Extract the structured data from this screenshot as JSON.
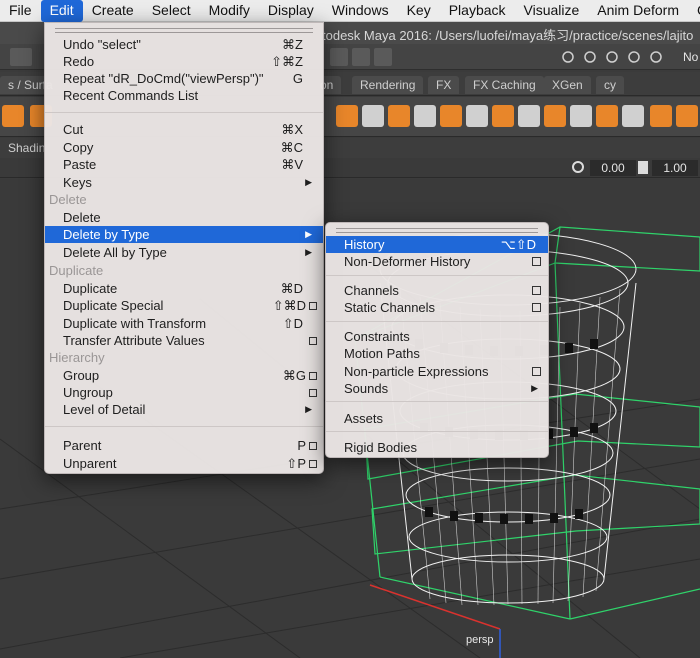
{
  "menubar": [
    {
      "label": "File"
    },
    {
      "label": "Edit"
    },
    {
      "label": "Create"
    },
    {
      "label": "Select"
    },
    {
      "label": "Modify"
    },
    {
      "label": "Display"
    },
    {
      "label": "Windows"
    },
    {
      "label": "Key"
    },
    {
      "label": "Playback"
    },
    {
      "label": "Visualize"
    },
    {
      "label": "Anim Deform"
    },
    {
      "label": "C"
    }
  ],
  "window_title": "todesk Maya 2016: /Users/luofei/maya练习/practice/scenes/lajito",
  "status_right": "No",
  "shelf_tabs": [
    "s / Surfa",
    "on",
    "Rendering",
    "FX",
    "FX Caching",
    "XGen",
    "cy"
  ],
  "panel_label": "Shadin",
  "viewport": {
    "field_a": "0.00",
    "field_b": "1.00",
    "camera": "persp"
  },
  "edit_menu": {
    "undo": {
      "label": "Undo \"select\"",
      "shortcut": "⌘Z"
    },
    "redo": {
      "label": "Redo",
      "shortcut": "⇧⌘Z"
    },
    "repeat": {
      "label": "Repeat \"dR_DoCmd(\"viewPersp\")\"",
      "shortcut": "G"
    },
    "recent": {
      "label": "Recent Commands List"
    },
    "cut": {
      "label": "Cut",
      "shortcut": "⌘X"
    },
    "copy": {
      "label": "Copy",
      "shortcut": "⌘C"
    },
    "paste": {
      "label": "Paste",
      "shortcut": "⌘V"
    },
    "keys": {
      "label": "Keys"
    },
    "hdr_delete": "Delete",
    "delete": {
      "label": "Delete"
    },
    "delete_by_type": {
      "label": "Delete by Type"
    },
    "delete_all_by_type": {
      "label": "Delete All by Type"
    },
    "hdr_duplicate": "Duplicate",
    "duplicate": {
      "label": "Duplicate",
      "shortcut": "⌘D"
    },
    "duplicate_special": {
      "label": "Duplicate Special",
      "shortcut": "⇧⌘D"
    },
    "duplicate_transform": {
      "label": "Duplicate with Transform",
      "shortcut": "⇧D"
    },
    "transfer": {
      "label": "Transfer Attribute Values"
    },
    "hdr_hierarchy": "Hierarchy",
    "group": {
      "label": "Group",
      "shortcut": "⌘G"
    },
    "ungroup": {
      "label": "Ungroup"
    },
    "lod": {
      "label": "Level of Detail"
    },
    "parent": {
      "label": "Parent",
      "shortcut": "P"
    },
    "unparent": {
      "label": "Unparent",
      "shortcut": "⇧P"
    }
  },
  "type_menu": {
    "history": {
      "label": "History",
      "shortcut": "⌥⇧D"
    },
    "non_deformer": {
      "label": "Non-Deformer History"
    },
    "channels": {
      "label": "Channels"
    },
    "static_channels": {
      "label": "Static Channels"
    },
    "constraints": {
      "label": "Constraints"
    },
    "motion_paths": {
      "label": "Motion Paths"
    },
    "non_particle": {
      "label": "Non-particle Expressions"
    },
    "sounds": {
      "label": "Sounds"
    },
    "assets": {
      "label": "Assets"
    },
    "rigid_bodies": {
      "label": "Rigid Bodies"
    }
  },
  "colors": {
    "highlight": "#1f68d8",
    "wire": "#f2f2f2",
    "bbox": "#2fd36a",
    "shelf_orange": "#e8862a"
  }
}
